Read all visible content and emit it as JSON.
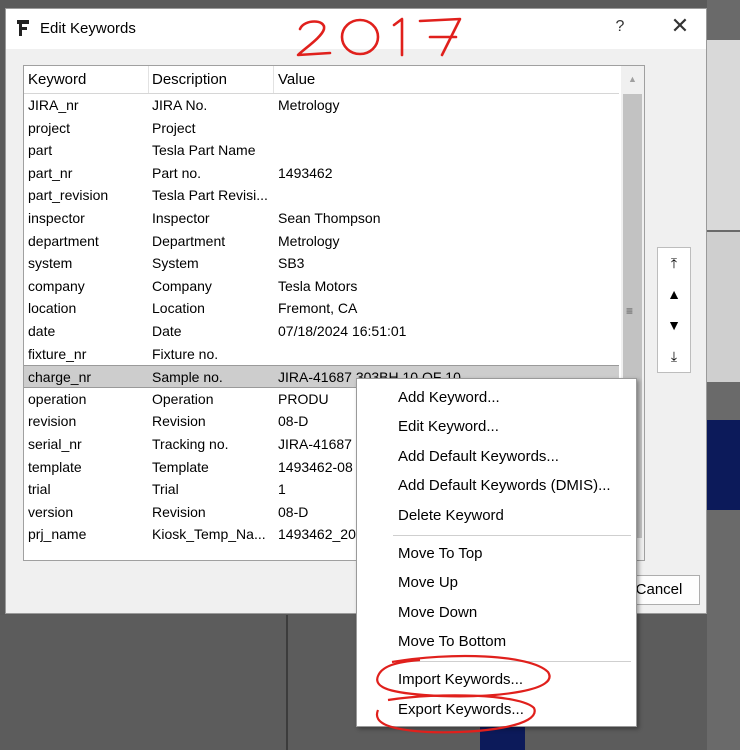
{
  "dialog": {
    "title": "Edit Keywords",
    "help_label": "?",
    "close_label": "✕",
    "cancel_label": "Cancel"
  },
  "annotation": {
    "text": "2017",
    "color": "#e0201c"
  },
  "table": {
    "headers": [
      "Keyword",
      "Description",
      "Value"
    ],
    "selected_index": 12,
    "rows": [
      {
        "k": "JIRA_nr",
        "d": "JIRA No.",
        "v": "Metrology"
      },
      {
        "k": "project",
        "d": "Project",
        "v": ""
      },
      {
        "k": "part",
        "d": "Tesla Part Name",
        "v": ""
      },
      {
        "k": "part_nr",
        "d": "Part no.",
        "v": "1493462"
      },
      {
        "k": "part_revision",
        "d": "Tesla Part Revisi...",
        "v": ""
      },
      {
        "k": "inspector",
        "d": "Inspector",
        "v": "Sean Thompson"
      },
      {
        "k": "department",
        "d": "Department",
        "v": "Metrology"
      },
      {
        "k": "system",
        "d": "System",
        "v": "SB3"
      },
      {
        "k": "company",
        "d": "Company",
        "v": "Tesla Motors"
      },
      {
        "k": "location",
        "d": "Location",
        "v": "Fremont, CA"
      },
      {
        "k": "date",
        "d": "Date",
        "v": "07/18/2024 16:51:01"
      },
      {
        "k": "fixture_nr",
        "d": "Fixture no.",
        "v": ""
      },
      {
        "k": "charge_nr",
        "d": "Sample no.",
        "v": "JIRA-41687 303BH 10 OF 10"
      },
      {
        "k": "operation",
        "d": "Operation",
        "v": "PRODU"
      },
      {
        "k": "revision",
        "d": "Revision",
        "v": "08-D"
      },
      {
        "k": "serial_nr",
        "d": "Tracking no.",
        "v": "JIRA-41687"
      },
      {
        "k": "template",
        "d": "Template",
        "v": "1493462-08"
      },
      {
        "k": "trial",
        "d": "Trial",
        "v": "1"
      },
      {
        "k": "version",
        "d": "Revision",
        "v": "08-D"
      },
      {
        "k": "prj_name",
        "d": "Kiosk_Temp_Na...",
        "v": "1493462_20"
      }
    ]
  },
  "side_buttons": [
    {
      "name": "move-to-top-button",
      "icon": "⤒"
    },
    {
      "name": "move-up-button",
      "icon": "▲"
    },
    {
      "name": "move-down-button",
      "icon": "▼"
    },
    {
      "name": "move-to-bottom-button",
      "icon": "⤓"
    }
  ],
  "scrollbar": {
    "up_icon": "▲",
    "grip_icon": "≡"
  },
  "context_menu": {
    "groups": [
      [
        "Add Keyword...",
        "Edit Keyword...",
        "Add Default Keywords...",
        "Add Default Keywords (DMIS)...",
        "Delete Keyword"
      ],
      [
        "Move To Top",
        "Move Up",
        "Move Down",
        "Move To Bottom"
      ],
      [
        "Import Keywords...",
        "Export Keywords..."
      ]
    ]
  }
}
